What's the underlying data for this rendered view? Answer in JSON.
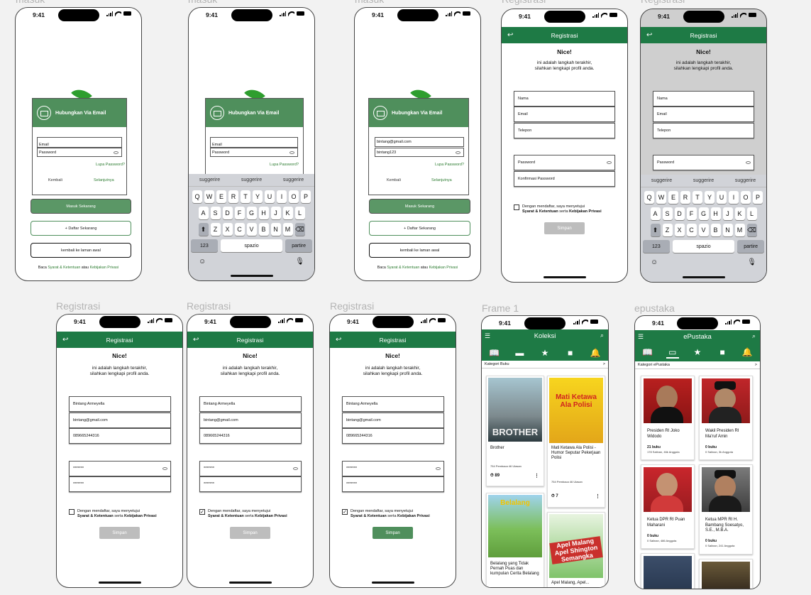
{
  "status": {
    "time": "9:41"
  },
  "frames": {
    "masuk": "masuk",
    "registrasi": "Registrasi",
    "frame1": "Frame 1",
    "epustaka": "epustaka"
  },
  "login": {
    "header": "Hubungkan Via Email",
    "email_placeholder": "Email",
    "password_placeholder": "Password",
    "email_value": "bintang@gmail.com",
    "password_value": "bintang123",
    "forgot": "Lupa Password?",
    "back": "Kembali",
    "next": "Selanjutnya",
    "login_btn": "Masuk Sekarang",
    "register_btn": "+ Daftar Sekarang",
    "home_btn": "kembali ke laman awal",
    "foot_pre": "Baca",
    "foot_terms": "Syarat & Ketentuan",
    "foot_mid": "atau",
    "foot_privacy": "Kebijakan Privasi"
  },
  "keyboard": {
    "suggestions": [
      "suggerire",
      "suggerire",
      "suggerire"
    ],
    "row1": [
      "Q",
      "W",
      "E",
      "R",
      "T",
      "Y",
      "U",
      "I",
      "O",
      "P"
    ],
    "row2": [
      "A",
      "S",
      "D",
      "F",
      "G",
      "H",
      "J",
      "K",
      "L"
    ],
    "row3": [
      "Z",
      "X",
      "C",
      "V",
      "B",
      "N",
      "M"
    ],
    "shift": "⬆",
    "del": "⌫",
    "num": "123",
    "space": "spazio",
    "go": "partire",
    "emoji": "☺",
    "mic": "🎙"
  },
  "reg": {
    "title": "Registrasi",
    "back_icon": "↩",
    "nice": "Nice!",
    "sub1": "ini adalah langkah terakhir,",
    "sub2": "silahkan lengkapi profil anda.",
    "name_ph": "Nama",
    "email_ph": "Email",
    "phone_ph": "Telepon",
    "pass_ph": "Password",
    "confirm_ph": "Konfirmasi Password",
    "name_val": "Bintang Armeyella",
    "email_val": "bintang@gmail.com",
    "phone_val": "089665244316",
    "pass_val": "*******",
    "confirm_val": "*******",
    "agree_pre": "Dengan mendaftar, saya menyetujui",
    "agree_terms": "Syarat & Ketentuan",
    "agree_mid": "serta",
    "agree_privacy": "Kebijakan Privasi",
    "save": "Simpan",
    "check": "✓"
  },
  "koleksi": {
    "title": "Koleksi",
    "category": "Kategori Buku",
    "more": ">",
    "tab_icons": [
      "book-open",
      "book",
      "star",
      "bag",
      "bell"
    ],
    "books": [
      {
        "title": "Brother",
        "meta": "754 Pembaca  46 Ulasan",
        "stock": "89",
        "cover_text": "BROTHER"
      },
      {
        "title": "Mati Ketawa Ala Polisi - Humor Seputar Pekerjaan Polisi",
        "meta": "754 Pembaca  46 Ulasan",
        "stock": "7",
        "cover_text": "Mati Ketawa Ala Polisi"
      },
      {
        "title": "Belalang yang Tidak Pernah Puas dan kumpulan Cerita Belalang",
        "meta": "",
        "stock": "",
        "cover_text": "Belalang"
      },
      {
        "title": "Apel Malang, Apel...",
        "meta": "",
        "stock": "",
        "cover_text": "Apel Malang Apel Shington Semangka"
      }
    ]
  },
  "epustaka": {
    "title": "ePustaka",
    "category": "Kategori ePustaka",
    "more": ">",
    "people": [
      {
        "name": "Presiden RI Joko Widodo",
        "books": "21 buku",
        "meta": "178 Salinan, 46k Anggota"
      },
      {
        "name": "Wakil Presiden RI Ma'ruf Amin",
        "books": "0 buku",
        "meta": "0 Salinan, 3k Anggota"
      },
      {
        "name": "Ketua DPR RI Puan Maharani",
        "books": "0 buku",
        "meta": "0 Salinan, 486 Anggota"
      },
      {
        "name": "Ketua MPR RI H. Bambang Soesatyo, S.E., M.B.A.",
        "books": "0 buku",
        "meta": "0 Salinan, 241 Anggota"
      }
    ]
  }
}
